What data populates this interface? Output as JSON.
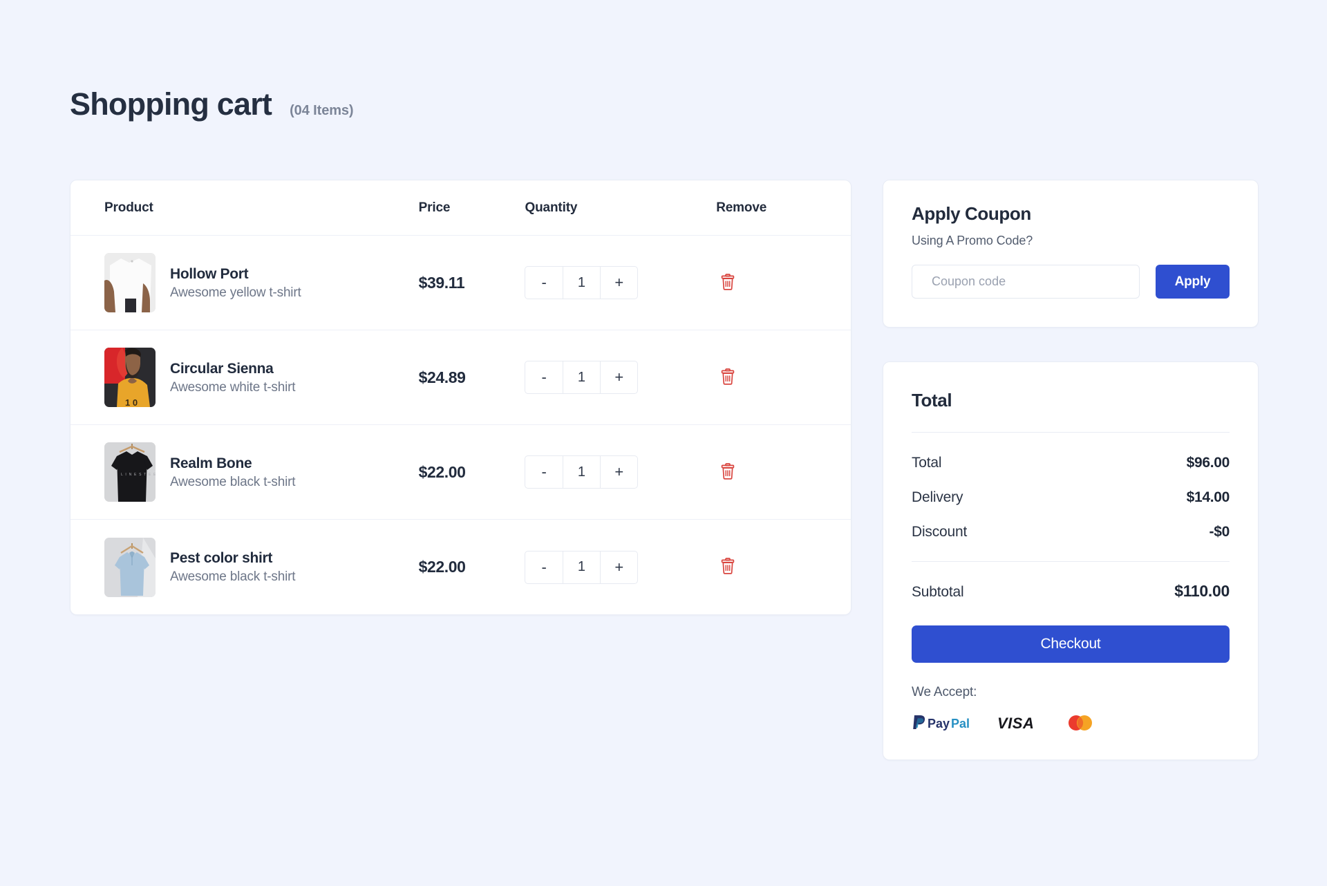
{
  "header": {
    "title": "Shopping cart",
    "item_count_label": "(04 Items)"
  },
  "cart": {
    "columns": {
      "product": "Product",
      "price": "Price",
      "quantity": "Quantity",
      "remove": "Remove"
    },
    "items": [
      {
        "name": "Hollow Port",
        "description": "Awesome yellow t-shirt",
        "price": "$39.11",
        "quantity": "1",
        "minus": "-",
        "plus": "+",
        "thumb": "white-tshirt-photo"
      },
      {
        "name": "Circular Sienna",
        "description": "Awesome white t-shirt",
        "price": "$24.89",
        "quantity": "1",
        "minus": "-",
        "plus": "+",
        "thumb": "man-yellow-tshirt-photo"
      },
      {
        "name": "Realm Bone",
        "description": "Awesome black t-shirt",
        "price": "$22.00",
        "quantity": "1",
        "minus": "-",
        "plus": "+",
        "thumb": "black-tshirt-hanger-photo"
      },
      {
        "name": "Pest color shirt",
        "description": "Awesome black t-shirt",
        "price": "$22.00",
        "quantity": "1",
        "minus": "-",
        "plus": "+",
        "thumb": "blue-tshirt-hanger-photo"
      }
    ]
  },
  "coupon": {
    "title": "Apply Coupon",
    "subtitle": "Using A Promo Code?",
    "input_value": "",
    "input_placeholder": "Coupon code",
    "apply_label": "Apply"
  },
  "total": {
    "title": "Total",
    "lines": [
      {
        "label": "Total",
        "value": "$96.00"
      },
      {
        "label": "Delivery",
        "value": "$14.00"
      },
      {
        "label": "Discount",
        "value": "-$0"
      }
    ],
    "subtotal_label": "Subtotal",
    "subtotal_value": "$110.00",
    "checkout_label": "Checkout",
    "accept_label": "We Accept:",
    "payment_methods": [
      "paypal-logo",
      "visa-logo",
      "mastercard-logo"
    ]
  },
  "colors": {
    "page_background": "#f1f4fd",
    "card_background": "#ffffff",
    "accent_blue": "#2f4fd0",
    "text_dark": "#222b3c",
    "text_muted": "#6d7688",
    "trash_red": "#d9453f",
    "border": "#e8ecf5"
  }
}
